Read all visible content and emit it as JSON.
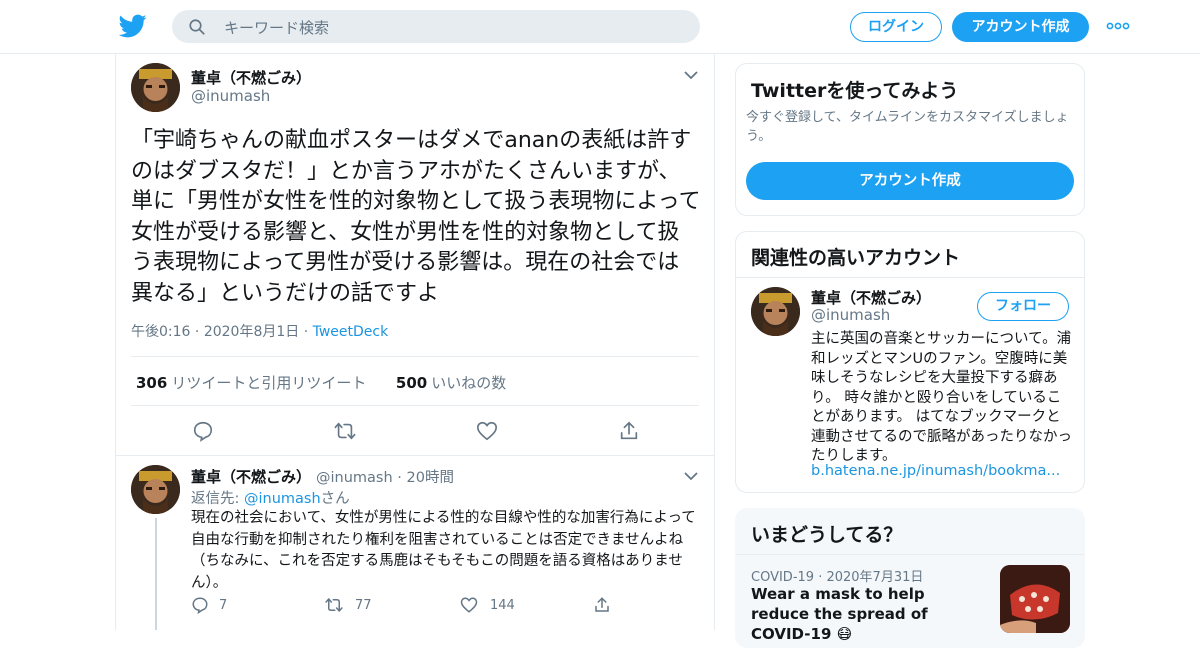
{
  "header": {
    "search_placeholder": "キーワード検索",
    "login_label": "ログイン",
    "signup_label": "アカウント作成"
  },
  "main_tweet": {
    "author_name": "董卓（不燃ごみ）",
    "author_handle": "@inumash",
    "text": "「宇崎ちゃんの献血ポスターはダメでananの表紙は許すのはダブスタだ！」とか言うアホがたくさんいますが、単に「男性が女性を性的対象物として扱う表現物によって女性が受ける影響と、女性が男性を性的対象物として扱う表現物によって男性が受ける影響は。現在の社会では異なる」というだけの話ですよ",
    "time": "午後0:16",
    "date": "2020年8月1日",
    "source": "TweetDeck",
    "retweets_count": "306",
    "retweets_label": "リツイートと引用リツイート",
    "likes_count": "500",
    "likes_label": "いいねの数"
  },
  "reply_tweet": {
    "author_name": "董卓（不燃ごみ）",
    "author_handle": "@inumash",
    "age": "20時間",
    "reply_to_prefix": "返信先: ",
    "reply_to_handle": "@inumash",
    "reply_to_suffix": "さん",
    "text": "現在の社会において、女性が男性による性的な目線や性的な加害行為によって自由な行動を抑制されたり権利を阻害されていることは否定できませんよね（ちなみに、これを否定する馬鹿はそもそもこの問題を語る資格はありません）。",
    "reply_count": "7",
    "retweet_count": "77",
    "like_count": "144"
  },
  "signup_card": {
    "title": "Twitterを使ってみよう",
    "subtitle": "今すぐ登録して、タイムラインをカスタマイズしましょう。",
    "button": "アカウント作成"
  },
  "related_card": {
    "title": "関連性の高いアカウント",
    "name": "董卓（不燃ごみ）",
    "handle": "@inumash",
    "follow_label": "フォロー",
    "bio": "主に英国の音楽とサッカーについて。浦和レッズとマンUのファン。空腹時に美味しそうなレシピを大量投下する癖あり。 時々誰かと殴り合いをしていることがあります。 はてなブックマークと連動させてるので脈略があったりなかったりします。",
    "url": "b.hatena.ne.jp/inumash/bookma..."
  },
  "trends_card": {
    "title": "いまどうしてる？",
    "trend_category": "COVID-19",
    "trend_date": "2020年7月31日",
    "trend_title": "Wear a mask to help reduce the spread of COVID-19 😷"
  },
  "colors": {
    "brand_blue": "#1da1f2",
    "link_blue": "#1b95e0",
    "muted_text": "#657786",
    "divider": "#e6ecf0"
  }
}
